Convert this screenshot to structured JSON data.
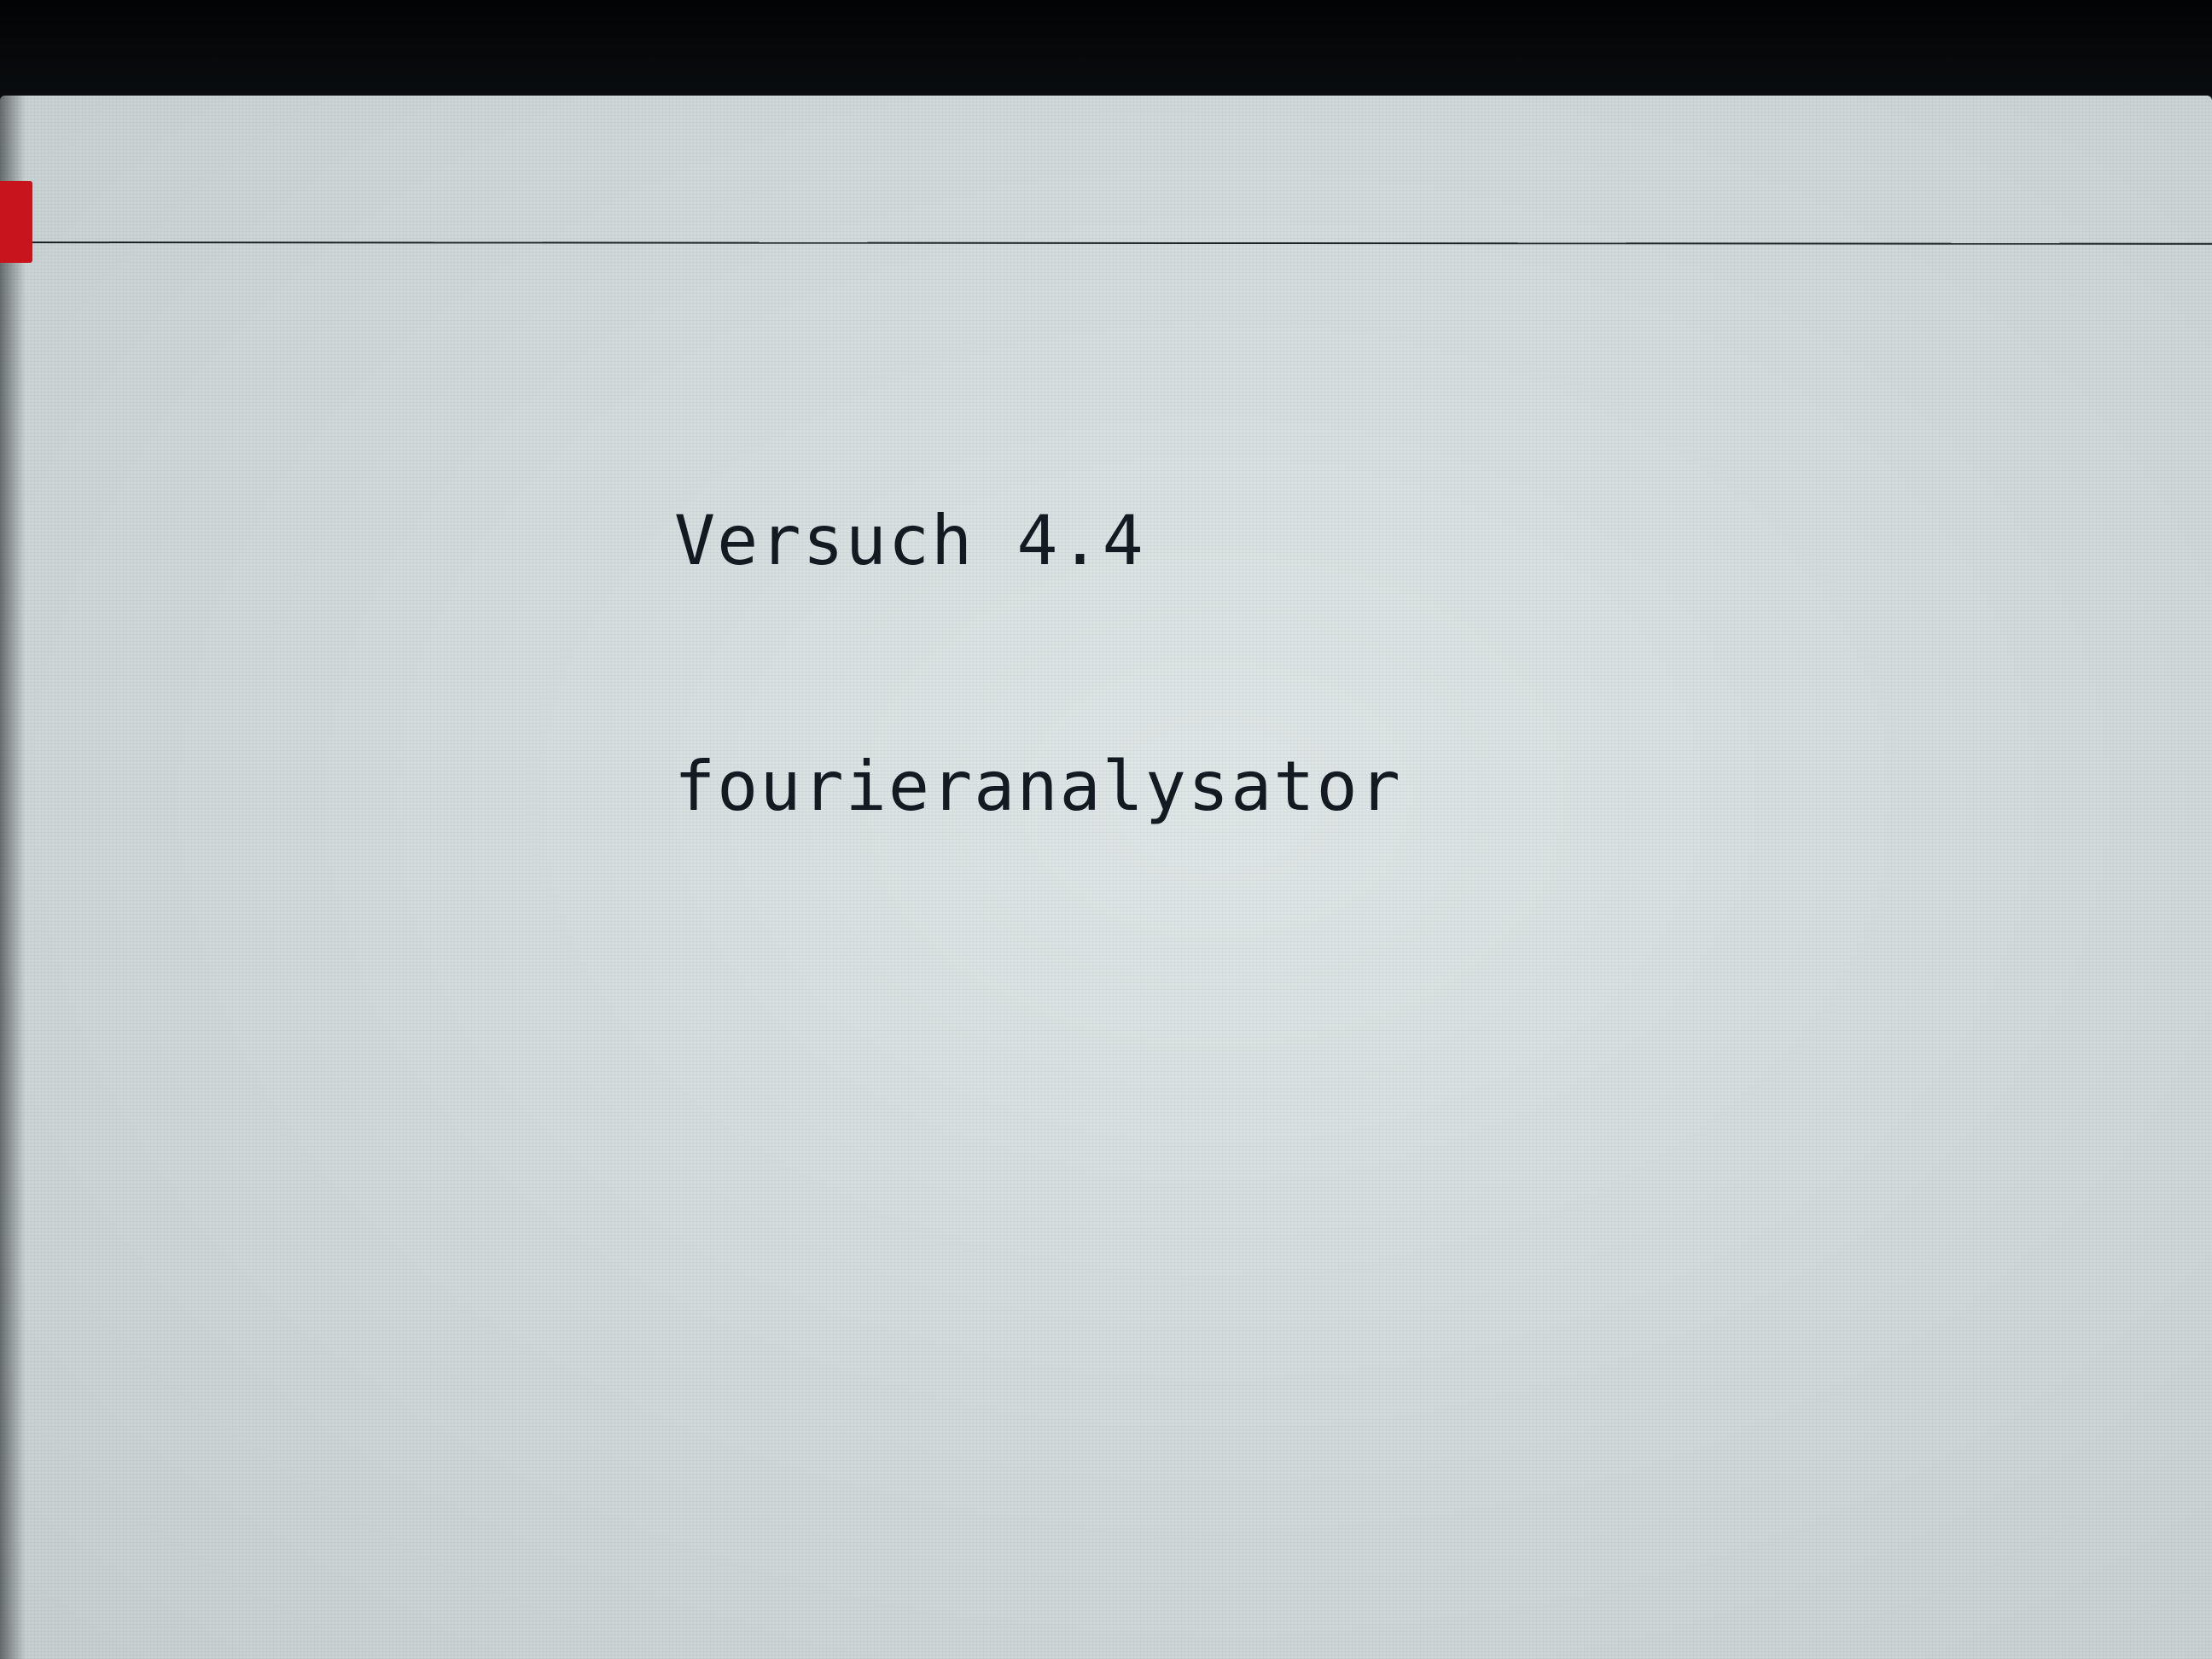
{
  "screen": {
    "title_line_1": "Versuch 4.4",
    "title_line_2": "fourieranalysator"
  },
  "colors": {
    "marker": "#c8141c",
    "text": "#131a22",
    "background": "#d8e0e1"
  }
}
